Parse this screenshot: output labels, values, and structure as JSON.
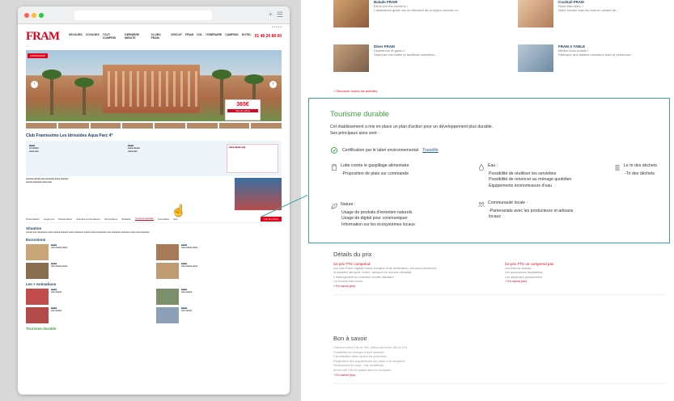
{
  "browser": {
    "page": {
      "logo": "FRAM",
      "phone": "01 48 24 88 00",
      "nav": [
        "SÉJOURS",
        "VOYAGES",
        "TOUT COMPRIS",
        "DERNIÈRE MINUTE",
        "CLUBS FRAM",
        "CIRCUIT",
        "FRAM",
        "VOL",
        "ITINÉRAIRE",
        "CAMPING",
        "HOTEL"
      ],
      "hero_label": "FRAMISSIMO",
      "price": "365€",
      "hotel_name": "Club Framissimo Les Idrissides Aqua Parc 4*",
      "button_label": "Voir les offres",
      "tabs": [
        "Présentation",
        "Logement",
        "Restauration",
        "Activités & Animations",
        "Informations",
        "Situation",
        "Tourisme durable",
        "Formalités",
        "Avis"
      ],
      "active_tab_index": 6,
      "book_label": "Voir les offres",
      "sections": {
        "situation": "Situation",
        "excursions": "Excursions",
        "loisirs": "Les + Animations",
        "tourisme": "Tourisme durable"
      }
    }
  },
  "top_cards": [
    {
      "title": "Balade FRAM",
      "line1": "Découvrir les environs !",
      "line2": "L'assistance guide vos en direction de la région comme un.."
    },
    {
      "title": "Cocktail FRAM",
      "line1": "Nous êtes allés ?",
      "line2": "Notre horaire tous les trois en venant de..."
    },
    {
      "title": "Dîner FRAM",
      "line1": "Expérience et gastro !",
      "line2": "Déjeunez rôti nulles et traditions culinaires..."
    },
    {
      "title": "FRAM A TABLE",
      "line1": "Mettez-vous à table !",
      "line2": "Participer aux ateliers culinaires avec le personnel..."
    }
  ],
  "top_link": "+ Découvrir toutes les activités",
  "durable": {
    "title": "Tourisme durable",
    "intro_line1": "Cet établissement a mis en place un plan d'action pour un développement plus durable.",
    "intro_line2": "Ses principaux axes sont :",
    "cert_text": "Certification par le label environnemental",
    "cert_link": "Travelife",
    "gaspillage": {
      "title": "Lutte contre le gaspillage alimentaire",
      "lines": [
        "-Proposition de plats sur commande"
      ]
    },
    "eau": {
      "title": "Eau :",
      "lines": [
        "Possibilité de réutiliser les serviettes",
        "Possibilité de renoncer au ménage quotidien",
        "Equipements économiseurs d'eau"
      ]
    },
    "dechets": {
      "title": "Le tri des déchets",
      "lines": [
        "-Tri des déchets"
      ]
    },
    "nature": {
      "title": "Nature :",
      "lines": [
        "Usage de produits d'entretien naturels",
        "Usage de digital pour communiquer",
        "Information sur les écosystèmes locaux"
      ]
    },
    "communaute": {
      "title": "Communauté locale :",
      "lines": [
        "-Partenariats avec les producteurs et artisans",
        "locaux"
      ]
    }
  },
  "details": {
    "title": "Détails du prix",
    "included_head": "Ce prix TTC comprend",
    "excluded_head": "Ce prix TTC ne comprend pas",
    "included_lines": [
      "Les vols Paris / Agadir inclus d'origine et de destination, les taxes aériennes",
      "le transfert aéroport / hôtel / aéroport en autocar climatisé",
      "L'hébergement en chambre double standard",
      "La formule tout inclus"
    ],
    "excluded_lines": [
      "Les frais de dossier",
      "Les assurances facultatives",
      "Les dépenses personnelles"
    ],
    "included_link": "+ En savoir plus",
    "excluded_link": "+ En savoir plus"
  },
  "bon_a_savoir": {
    "title": "Bon à savoir",
    "lines": [
      "Check-in entre 14h et 15h, check-out entre 10h et 12h.",
      "Possibilité de changer à tout moment.",
      "Climatisation dans toutes les chambres.",
      "Réglement des suppléments sur place à la réception.",
      "Ressources du pays : voir conditions.",
      "Accès wifi 24h/24 gratuit dans la réception."
    ],
    "link": "+ En savoir plus"
  },
  "colors": {
    "brand_red": "#e2001a",
    "green_title": "#3ea541",
    "teal_border": "#3aa0a6",
    "link_blue": "#1a5bb5"
  }
}
